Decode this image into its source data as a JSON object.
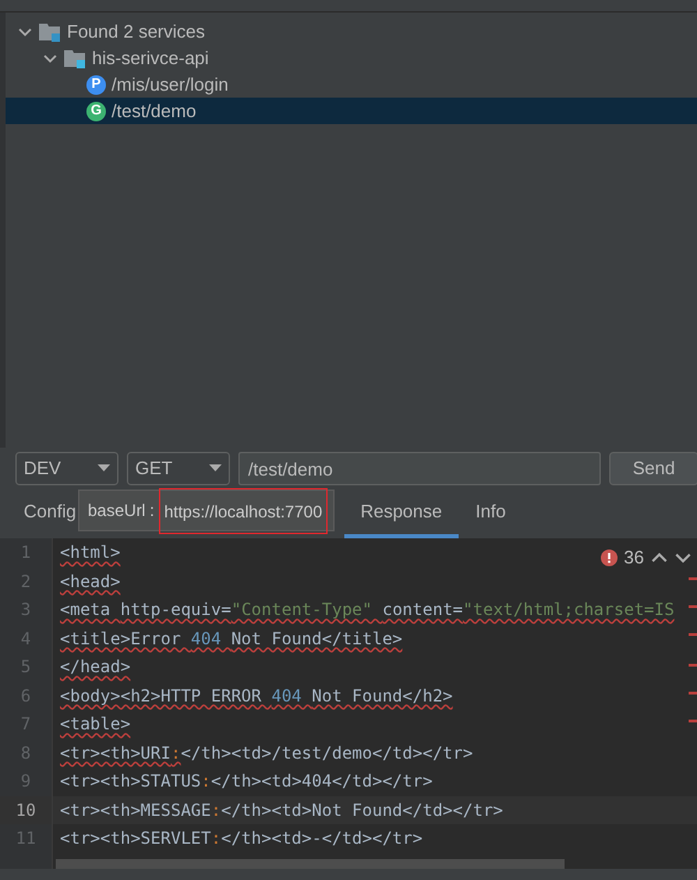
{
  "tree": [
    {
      "label": "Found 2 services",
      "kind": "root",
      "expanded": true,
      "selected": false,
      "children": [
        {
          "label": "his-serivce-api",
          "kind": "folder",
          "expanded": true,
          "selected": false,
          "children": [
            {
              "label": "/mis/user/login",
              "kind": "endpoint",
              "method": "P",
              "color": "#3d8ef0",
              "selected": false
            },
            {
              "label": "/test/demo",
              "kind": "endpoint",
              "method": "G",
              "color": "#3cb371",
              "selected": true
            }
          ]
        }
      ]
    }
  ],
  "request": {
    "environment": "DEV",
    "method": "GET",
    "url": "/test/demo",
    "send": "Send"
  },
  "tabs": [
    {
      "label": "Config",
      "selected": false
    },
    {
      "label": "Response",
      "selected": true
    },
    {
      "label": "Info",
      "selected": false
    }
  ],
  "tooltip": {
    "key": "baseUrl",
    "separator": ":",
    "value": "https://localhost:7700"
  },
  "editor": {
    "error_count": "36",
    "lines": [
      {
        "number": "1",
        "selected": false,
        "segments": [
          {
            "text": "<html>",
            "kind": "tag",
            "error": true
          }
        ]
      },
      {
        "number": "2",
        "selected": false,
        "segments": [
          {
            "text": "<head>",
            "kind": "tag",
            "error": true
          }
        ]
      },
      {
        "number": "3",
        "selected": false,
        "segments": [
          {
            "text": "<meta ",
            "kind": "tag",
            "error": true
          },
          {
            "text": "http-equiv=",
            "kind": "tag",
            "error": true
          },
          {
            "text": "\"Content-Type\" ",
            "kind": "string",
            "error": true
          },
          {
            "text": "content=",
            "kind": "tag",
            "error": true
          },
          {
            "text": "\"text/html;charset=IS",
            "kind": "string",
            "error": true
          }
        ]
      },
      {
        "number": "4",
        "selected": false,
        "segments": [
          {
            "text": "<title>Error ",
            "kind": "tag",
            "error": true
          },
          {
            "text": "404 ",
            "kind": "number",
            "error": true
          },
          {
            "text": "Not Found</title>",
            "kind": "tag",
            "error": true
          }
        ]
      },
      {
        "number": "5",
        "selected": false,
        "segments": [
          {
            "text": "</head>",
            "kind": "tag",
            "error": true
          }
        ]
      },
      {
        "number": "6",
        "selected": false,
        "segments": [
          {
            "text": "<body><h2>HTTP ERROR ",
            "kind": "tag",
            "error": true
          },
          {
            "text": "404 ",
            "kind": "number",
            "error": true
          },
          {
            "text": "Not Found</h2>",
            "kind": "tag",
            "error": true
          }
        ]
      },
      {
        "number": "7",
        "selected": false,
        "segments": [
          {
            "text": "<table>",
            "kind": "tag",
            "error": true
          }
        ]
      },
      {
        "number": "8",
        "selected": false,
        "segments": [
          {
            "text": "<tr><th>URI",
            "kind": "tag",
            "error": true
          },
          {
            "text": ":",
            "kind": "punct",
            "error": true
          },
          {
            "text": "</th><td>/test/demo</td></tr>",
            "kind": "tag",
            "error": false
          }
        ]
      },
      {
        "number": "9",
        "selected": false,
        "segments": [
          {
            "text": "<tr><th>STATUS",
            "kind": "tag",
            "error": false
          },
          {
            "text": ":",
            "kind": "punct",
            "error": false
          },
          {
            "text": "</th><td>404</td></tr>",
            "kind": "tag",
            "error": false
          }
        ]
      },
      {
        "number": "10",
        "selected": true,
        "segments": [
          {
            "text": "<tr><th>MESSAGE",
            "kind": "tag",
            "error": false
          },
          {
            "text": ":",
            "kind": "punct",
            "error": false
          },
          {
            "text": "</th><td>Not Found</td></tr>",
            "kind": "tag",
            "error": false
          }
        ]
      },
      {
        "number": "11",
        "selected": false,
        "segments": [
          {
            "text": "<tr><th>SERVLET",
            "kind": "tag",
            "error": false
          },
          {
            "text": ":",
            "kind": "punct",
            "error": false
          },
          {
            "text": "</th><td>-</td></tr>",
            "kind": "tag",
            "error": false
          }
        ]
      }
    ]
  }
}
